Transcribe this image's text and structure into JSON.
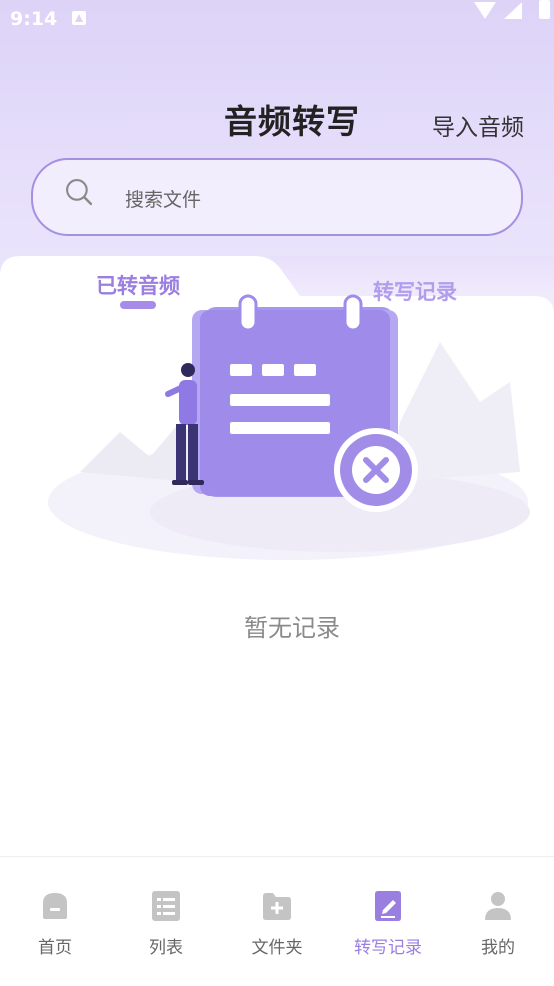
{
  "status_bar": {
    "time": "9:14"
  },
  "header": {
    "title": "音频转写",
    "import_label": "导入音频"
  },
  "search": {
    "placeholder": "搜索文件"
  },
  "tabs": [
    {
      "label": "已转音频",
      "active": true
    },
    {
      "label": "转写记录",
      "active": false
    }
  ],
  "empty_state": {
    "text": "暂无记录"
  },
  "bottom_nav": {
    "items": [
      {
        "label": "首页",
        "icon": "home-icon"
      },
      {
        "label": "列表",
        "icon": "list-icon"
      },
      {
        "label": "文件夹",
        "icon": "folder-add-icon"
      },
      {
        "label": "转写记录",
        "icon": "edit-document-icon",
        "active": true
      },
      {
        "label": "我的",
        "icon": "user-icon"
      }
    ]
  },
  "colors": {
    "accent": "#9a7ee0",
    "header_bg": "#dcd3f7",
    "inactive": "#c4c4c4"
  }
}
